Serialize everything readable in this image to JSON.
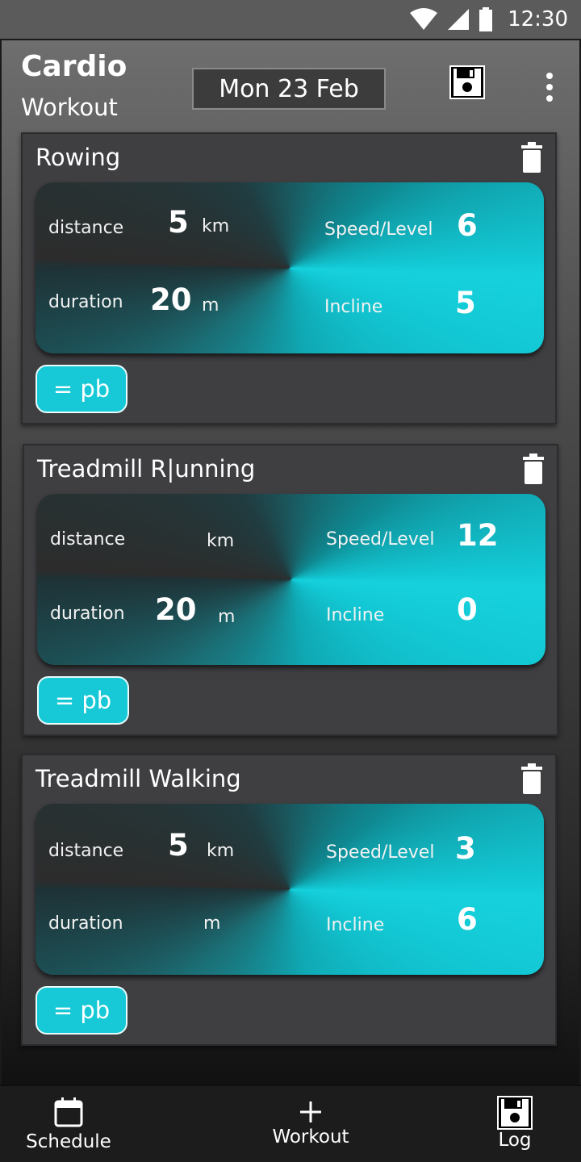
{
  "status_bar": {
    "time": "12:30"
  },
  "header": {
    "title": "Cardio",
    "subtitle": "Workout",
    "date": "Mon 23 Feb"
  },
  "exercises": [
    {
      "name": "Rowing",
      "distance_label": "distance",
      "distance_value": "5",
      "distance_unit": "km",
      "duration_label": "duration",
      "duration_value": "20",
      "duration_unit": "m",
      "speed_label": "Speed/Level",
      "speed_value": "6",
      "incline_label": "Incline",
      "incline_value": "5",
      "pb_label": "= pb"
    },
    {
      "name": "Treadmill R|unning",
      "distance_label": "distance",
      "distance_value": "",
      "distance_unit": "km",
      "duration_label": "duration",
      "duration_value": "20",
      "duration_unit": "m",
      "speed_label": "Speed/Level",
      "speed_value": "12",
      "incline_label": "Incline",
      "incline_value": "0",
      "pb_label": "= pb"
    },
    {
      "name": "Treadmill Walking",
      "distance_label": "distance",
      "distance_value": "5",
      "distance_unit": "km",
      "duration_label": "duration",
      "duration_value": "",
      "duration_unit": "m",
      "speed_label": "Speed/Level",
      "speed_value": "3",
      "incline_label": "Incline",
      "incline_value": "6",
      "pb_label": "= pb"
    }
  ],
  "bottom_nav": {
    "schedule": "Schedule",
    "workout": "Workout",
    "log": "Log"
  },
  "colors": {
    "accent": "#17c9d6",
    "card_bg": "#3f3f42"
  },
  "icons": [
    "wifi-icon",
    "signal-icon",
    "battery-icon",
    "save-icon",
    "more-vert-icon",
    "trash-icon",
    "calendar-icon",
    "plus-icon"
  ]
}
